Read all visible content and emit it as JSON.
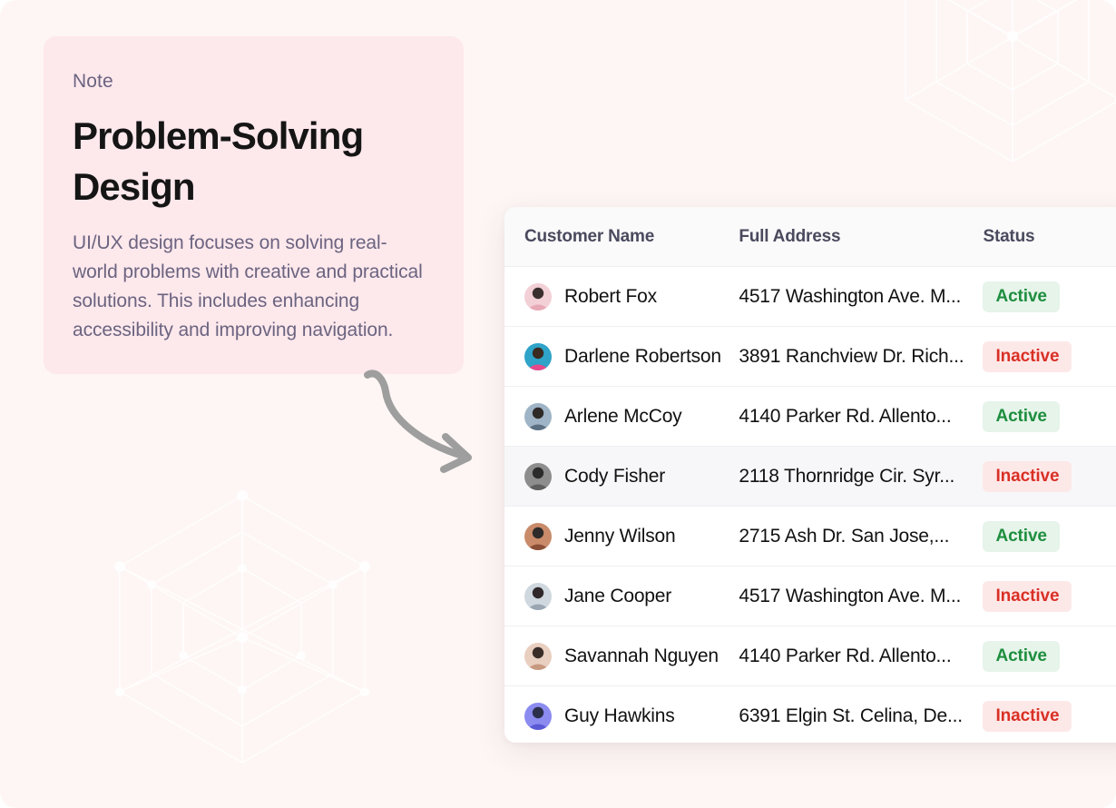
{
  "theme": {
    "background": "#fdf6f4",
    "note_card_bg": "#fde8ec",
    "table_bg": "#ffffff",
    "header_bg": "#fafafb",
    "row_alt_bg": "#f7f7f9",
    "active_text": "#1e8e3e",
    "active_bg": "#e6f4ea",
    "inactive_text": "#d93025",
    "inactive_bg": "#fde8e8",
    "muted_text": "#6b6480",
    "arrow_color": "#9e9e9e"
  },
  "note": {
    "label": "Note",
    "title": "Problem-Solving Design",
    "description": "UI/UX design focuses on solving real-world problems with creative and practical solutions. This includes enhancing accessibility and improving navigation."
  },
  "decorations": {
    "arrow": "curved-arrow-icon",
    "wireframe_top_right": "isometric-cube-wireframe-icon",
    "wireframe_bottom_left": "isometric-cube-wireframe-icon"
  },
  "table": {
    "columns": [
      "Customer Name",
      "Full Address",
      "Status"
    ],
    "rows": [
      {
        "name": "Robert Fox",
        "address": "4517 Washington Ave. M...",
        "status": "Active",
        "avatar": "avatar-robert-fox",
        "highlighted": false
      },
      {
        "name": "Darlene Robertson",
        "address": "3891 Ranchview Dr. Rich...",
        "status": "Inactive",
        "avatar": "avatar-darlene-robertson",
        "highlighted": false
      },
      {
        "name": "Arlene McCoy",
        "address": "4140 Parker Rd. Allento...",
        "status": "Active",
        "avatar": "avatar-arlene-mccoy",
        "highlighted": false
      },
      {
        "name": "Cody Fisher",
        "address": "2118 Thornridge Cir. Syr...",
        "status": "Inactive",
        "avatar": "avatar-cody-fisher",
        "highlighted": true
      },
      {
        "name": "Jenny Wilson",
        "address": "2715 Ash Dr. San Jose,...",
        "status": "Active",
        "avatar": "avatar-jenny-wilson",
        "highlighted": false
      },
      {
        "name": "Jane Cooper",
        "address": "4517 Washington Ave. M...",
        "status": "Inactive",
        "avatar": "avatar-jane-cooper",
        "highlighted": false
      },
      {
        "name": "Savannah Nguyen",
        "address": "4140 Parker Rd. Allento...",
        "status": "Active",
        "avatar": "avatar-savannah-nguyen",
        "highlighted": false
      },
      {
        "name": "Guy Hawkins",
        "address": "6391 Elgin St. Celina, De...",
        "status": "Inactive",
        "avatar": "avatar-guy-hawkins",
        "highlighted": false
      }
    ]
  }
}
